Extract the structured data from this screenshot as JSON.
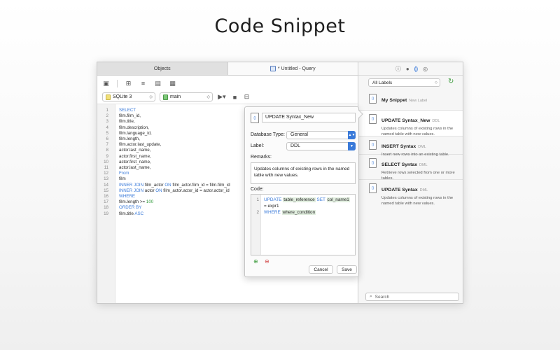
{
  "page": {
    "title": "Code Snippet"
  },
  "tabs": [
    {
      "label": "Objects"
    },
    {
      "label": "* Untitled - Query"
    }
  ],
  "selectors": {
    "connection": "SQLite 3",
    "database": "main"
  },
  "editor": {
    "lines": [
      {
        "n": "1",
        "parts": [
          [
            "kw",
            "SELECT"
          ]
        ]
      },
      {
        "n": "2",
        "parts": [
          [
            "t",
            "film.film_id,"
          ]
        ]
      },
      {
        "n": "3",
        "parts": [
          [
            "t",
            "film.title,"
          ]
        ]
      },
      {
        "n": "4",
        "parts": [
          [
            "t",
            "film.description,"
          ]
        ]
      },
      {
        "n": "5",
        "parts": [
          [
            "t",
            "film.language_id,"
          ]
        ]
      },
      {
        "n": "6",
        "parts": [
          [
            "t",
            "film.length,"
          ]
        ]
      },
      {
        "n": "7",
        "parts": [
          [
            "t",
            "film.actor.last_update,"
          ]
        ]
      },
      {
        "n": "8",
        "parts": [
          [
            "t",
            "actor.last_name,"
          ]
        ]
      },
      {
        "n": "9",
        "parts": [
          [
            "t",
            "actor.first_name,"
          ]
        ]
      },
      {
        "n": "10",
        "parts": [
          [
            "t",
            "actor.first_name,"
          ]
        ]
      },
      {
        "n": "11",
        "parts": [
          [
            "t",
            "actor.last_name,"
          ]
        ]
      },
      {
        "n": "12",
        "parts": [
          [
            "kw",
            "From"
          ]
        ]
      },
      {
        "n": "13",
        "parts": [
          [
            "t",
            "film"
          ]
        ]
      },
      {
        "n": "14",
        "parts": [
          [
            "kw",
            "INNER JOIN"
          ],
          [
            "t",
            " film_actor "
          ],
          [
            "kw",
            "ON"
          ],
          [
            "t",
            " film_actor.film_id = film.film_id"
          ]
        ]
      },
      {
        "n": "15",
        "parts": [
          [
            "kw",
            "INNER JOIN"
          ],
          [
            "t",
            " actor "
          ],
          [
            "kw",
            "ON"
          ],
          [
            "t",
            " film_actor.actor_id = actor.actor_id"
          ]
        ]
      },
      {
        "n": "16",
        "parts": [
          [
            "kw",
            "WHERE"
          ]
        ]
      },
      {
        "n": "17",
        "parts": [
          [
            "t",
            "film.length >= "
          ],
          [
            "num",
            "100"
          ]
        ]
      },
      {
        "n": "18",
        "parts": [
          [
            "kw",
            "ORDER BY"
          ]
        ]
      },
      {
        "n": "19",
        "parts": [
          [
            "t",
            "film.title "
          ],
          [
            "kw",
            "ASC"
          ]
        ]
      }
    ]
  },
  "sidebar": {
    "label_filter": "All Labels",
    "search_placeholder": "Search",
    "snippets": [
      {
        "name": "My Snippet",
        "tag": "New Label",
        "desc": ""
      },
      {
        "name": "UPDATE Syntax_New",
        "tag": "DDL",
        "desc": "Updates columns of existing rows in the named table with new values."
      },
      {
        "name": "INSERT Syntax",
        "tag": "DML",
        "desc": "Insert new rows into an existing table."
      },
      {
        "name": "SELECT Syntax",
        "tag": "DML",
        "desc": "Retrieve rows selected from one or more tables."
      },
      {
        "name": "UPDATE Syntax",
        "tag": "DML",
        "desc": "Updates columns of existing rows in the named table with new values."
      }
    ]
  },
  "snippet_editor": {
    "name": "UPDATE Syntax_New",
    "db_type_label": "Database Type:",
    "db_type_value": "General",
    "label_label": "Label:",
    "label_value": "DDL",
    "remarks_label": "Remarks:",
    "remarks": "Updates columns of existing rows in the named table with new values.",
    "code_label": "Code:",
    "code": {
      "l1_n": "1",
      "l1_kw1": "UPDATE",
      "l1_ph1": "table_reference",
      "l1_kw2": "SET",
      "l1_ph2": "col_name1",
      "l1_cont": "= expr1",
      "l2_n": "2",
      "l2_kw": "WHERE",
      "l2_ph": "where_condition"
    },
    "cancel": "Cancel",
    "save": "Save"
  }
}
